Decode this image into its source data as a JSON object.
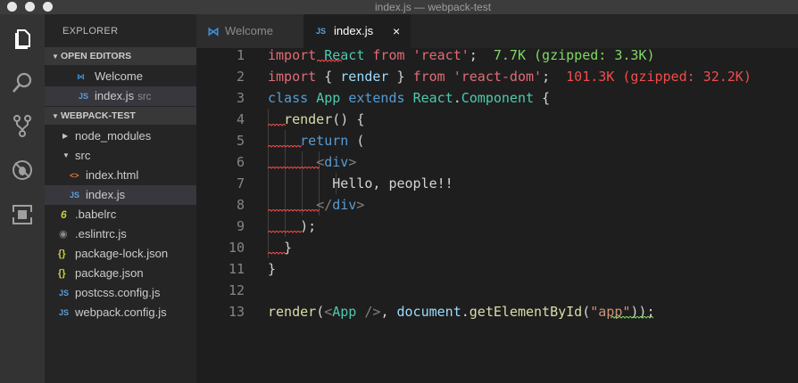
{
  "window": {
    "title": "index.js — webpack-test"
  },
  "activity_bar": {
    "icons": [
      "files-icon",
      "search-icon",
      "source-control-icon",
      "debug-icon",
      "extensions-icon"
    ]
  },
  "sidebar": {
    "header": "EXPLORER",
    "open_editors": {
      "label": "OPEN EDITORS",
      "items": [
        {
          "name": "Welcome",
          "icon": "vscode-icon"
        },
        {
          "name": "index.js",
          "icon": "js-icon",
          "path": "src"
        }
      ]
    },
    "project": {
      "label": "WEBPACK-TEST",
      "items": [
        {
          "name": "node_modules",
          "icon": ""
        },
        {
          "name": "src",
          "icon": ""
        },
        {
          "name": "index.html",
          "icon": "html-icon",
          "glyph": "<>"
        },
        {
          "name": "index.js",
          "icon": "js-icon",
          "glyph": "JS"
        },
        {
          "name": ".babelrc",
          "icon": "babel-icon",
          "glyph": "6"
        },
        {
          "name": ".eslintrc.js",
          "icon": "dot-icon",
          "glyph": "◉"
        },
        {
          "name": "package-lock.json",
          "icon": "json-icon",
          "glyph": "{}"
        },
        {
          "name": "package.json",
          "icon": "json-icon",
          "glyph": "{}"
        },
        {
          "name": "postcss.config.js",
          "icon": "js-icon",
          "glyph": "JS"
        },
        {
          "name": "webpack.config.js",
          "icon": "js-icon",
          "glyph": "JS"
        }
      ]
    },
    "js_glyph": "JS"
  },
  "tabs": [
    {
      "label": "Welcome",
      "active": false
    },
    {
      "label": "index.js",
      "active": true,
      "icon_text": "JS",
      "close": "×"
    }
  ],
  "editor": {
    "line_numbers": [
      "1",
      "2",
      "3",
      "4",
      "5",
      "6",
      "7",
      "8",
      "9",
      "10",
      "11",
      "12",
      "13"
    ],
    "l1": {
      "a": "import",
      "b": " React ",
      "c": "from",
      "d": " 'react'",
      "e": ";",
      "f": "  7.7K (gzipped: 3.3K)"
    },
    "l2": {
      "a": "import",
      "b": " { ",
      "c": "render",
      "d": " } ",
      "e": "from",
      "f": " 'react-dom'",
      "g": ";",
      "h": "  101.3K (gzipped: 32.2K)"
    },
    "l3": {
      "a": "class",
      "b": " ",
      "c": "App",
      "d": " ",
      "e": "extends",
      "f": " ",
      "g": "React",
      "h": ".",
      "i": "Component",
      "j": " {"
    },
    "l4": {
      "a": "  ",
      "b": "render",
      "c": "() {"
    },
    "l5": {
      "a": "    ",
      "b": "return",
      "c": " ("
    },
    "l6": {
      "a": "      ",
      "b": "<",
      "c": "div",
      "d": ">"
    },
    "l7": {
      "a": "        Hello, people!!"
    },
    "l8": {
      "a": "      ",
      "b": "</",
      "c": "div",
      "d": ">"
    },
    "l9": {
      "a": "    );"
    },
    "l10": {
      "a": "  }"
    },
    "l11": {
      "a": "}"
    },
    "l13": {
      "a": "render",
      "b": "(",
      "c": "<",
      "d": "App",
      "e": " />",
      "f": ", ",
      "g": "document",
      "h": ".",
      "i": "getElementById",
      "j": "(",
      "k": "\"app\"",
      "l": "));"
    }
  },
  "colors": {
    "size_ok": "#7fd962",
    "size_large": "#f14c4c",
    "squiggle_error": "#f14c4c",
    "squiggle_warning": "#7fd962"
  }
}
